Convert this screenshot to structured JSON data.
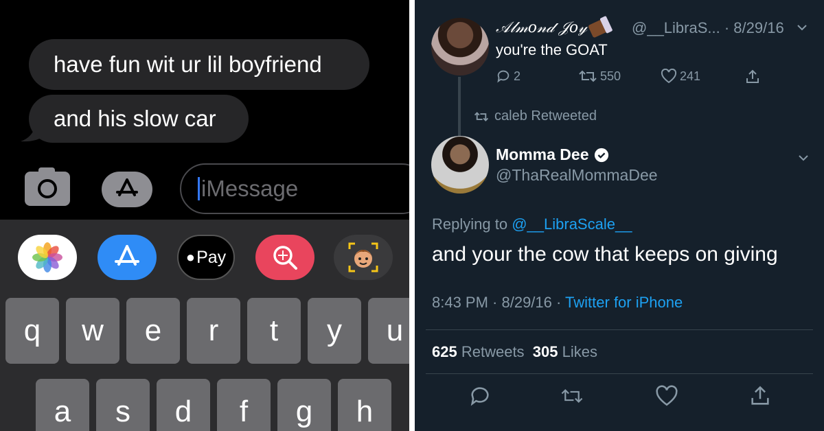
{
  "imessage": {
    "messages": [
      "have fun wit ur lil boyfriend",
      "and his slow car"
    ],
    "input_placeholder": "iMessage",
    "apps": [
      "photos-icon",
      "app-store-icon",
      "apple-pay-icon",
      "search-images-icon",
      "memoji-icon"
    ],
    "pay_label": "Pay",
    "keyboard_row1": [
      "q",
      "w",
      "e",
      "r",
      "t",
      "y",
      "u"
    ],
    "keyboard_row2": [
      "a",
      "s",
      "d",
      "f",
      "g",
      "h"
    ],
    "colors": {
      "bubble": "#262628",
      "caret": "#3478f6",
      "appstore": "#2f8cf6",
      "search": "#e9455d"
    }
  },
  "tweet_parent": {
    "display_name": "𝒜𝓁𝓂𝑜𝓃𝒹 𝒥𝑜𝓎",
    "handle_date": "@__LibraS... · 8/29/16",
    "text": "you're the GOAT",
    "replies": "2",
    "retweets": "550",
    "likes": "241"
  },
  "retweet_banner": "caleb Retweeted",
  "tweet_main": {
    "display_name": "Momma Dee",
    "handle": "@ThaRealMommaDee",
    "replying_prefix": "Replying to",
    "replying_mention": "@__LibraScale__",
    "text": "and your the cow that keeps on giving",
    "time": "8:43 PM · 8/29/16 ·",
    "source": "Twitter for iPhone",
    "retweet_count": "625",
    "retweet_label": "Retweets",
    "like_count": "305",
    "like_label": "Likes"
  },
  "colors": {
    "twitter_bg": "#15202b",
    "twitter_link": "#1da1f2",
    "twitter_muted": "#8899a6"
  }
}
